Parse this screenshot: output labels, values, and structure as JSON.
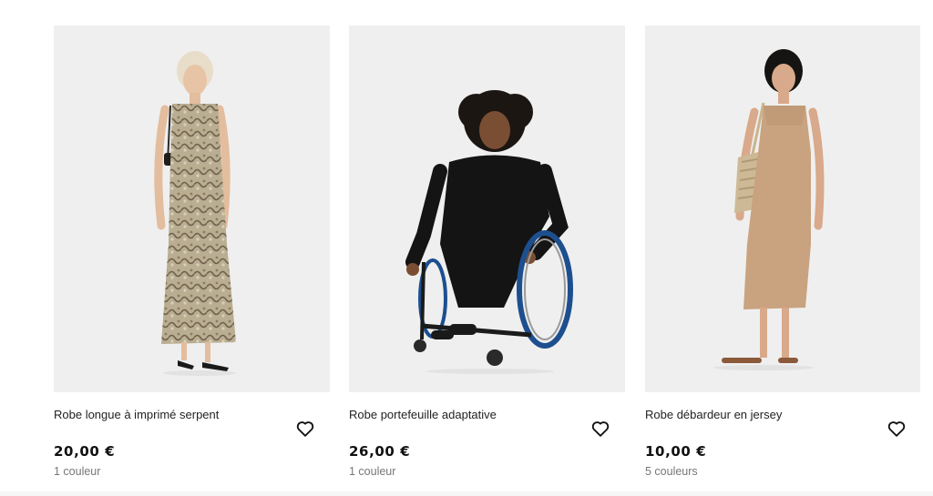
{
  "products": [
    {
      "title": "Robe longue à imprimé serpent",
      "price": "20,00 €",
      "colors": "1 couleur",
      "icon": "heart-outline-icon"
    },
    {
      "title": "Robe portefeuille adaptative",
      "price": "26,00 €",
      "colors": "1 couleur",
      "icon": "heart-outline-icon"
    },
    {
      "title": "Robe débardeur en jersey",
      "price": "10,00 €",
      "colors": "5 couleurs",
      "icon": "heart-outline-icon"
    }
  ],
  "colors": {
    "image_background": "#efefef",
    "price_text": "#111111",
    "secondary_text": "#777777"
  }
}
